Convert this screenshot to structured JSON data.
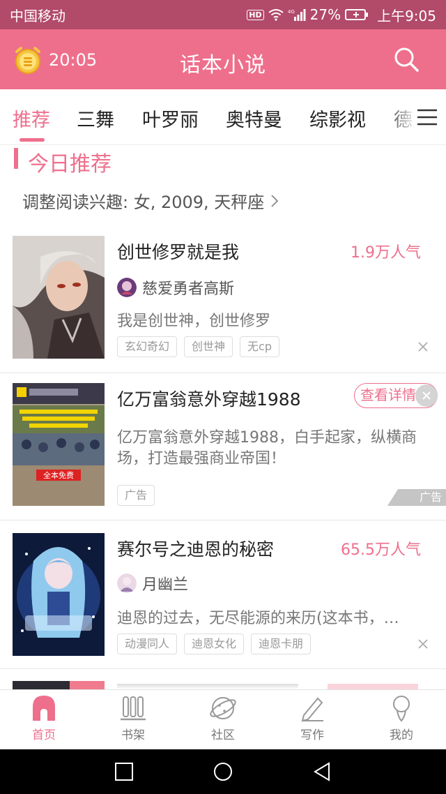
{
  "status_bar": {
    "carrier": "中国移动",
    "hd": "HD",
    "network": "4G",
    "battery": "27%",
    "time": "上午9:05"
  },
  "header": {
    "time": "20:05",
    "title": "话本小说"
  },
  "tabs": [
    {
      "label": "推荐",
      "active": true
    },
    {
      "label": "三舞"
    },
    {
      "label": "叶罗丽"
    },
    {
      "label": "奥特曼"
    },
    {
      "label": "综影视"
    },
    {
      "label": "德"
    }
  ],
  "section": {
    "title": "今日推荐",
    "interest": "调整阅读兴趣: 女, 2009, 天秤座"
  },
  "books": [
    {
      "title": "创世修罗就是我",
      "popularity": "1.9万人气",
      "author": "慈爱勇者高斯",
      "desc": "我是创世神，创世修罗",
      "tags": [
        "玄幻奇幻",
        "创世神",
        "无cp"
      ]
    },
    {
      "title": "亿万富翁意外穿越1988",
      "detail_button": "查看详情",
      "desc": "亿万富翁意外穿越1988，白手起家，纵横商场，打造最强商业帝国！",
      "tags": [
        "广告"
      ],
      "ad_label": "广告",
      "cover_texts": [
        "全本免费"
      ]
    },
    {
      "title": "赛尔号之迪恩的秘密",
      "popularity": "65.5万人气",
      "author": "月幽兰",
      "desc": "迪恩的过去，无尽能源的来历(这本书，…",
      "tags": [
        "动漫同人",
        "迪恩女化",
        "迪恩卡朋"
      ]
    }
  ],
  "nav": [
    {
      "label": "首页",
      "active": true
    },
    {
      "label": "书架"
    },
    {
      "label": "社区"
    },
    {
      "label": "写作"
    },
    {
      "label": "我的"
    }
  ],
  "colors": {
    "accent": "#ee6f8c",
    "status_bar": "#b24a6a"
  }
}
